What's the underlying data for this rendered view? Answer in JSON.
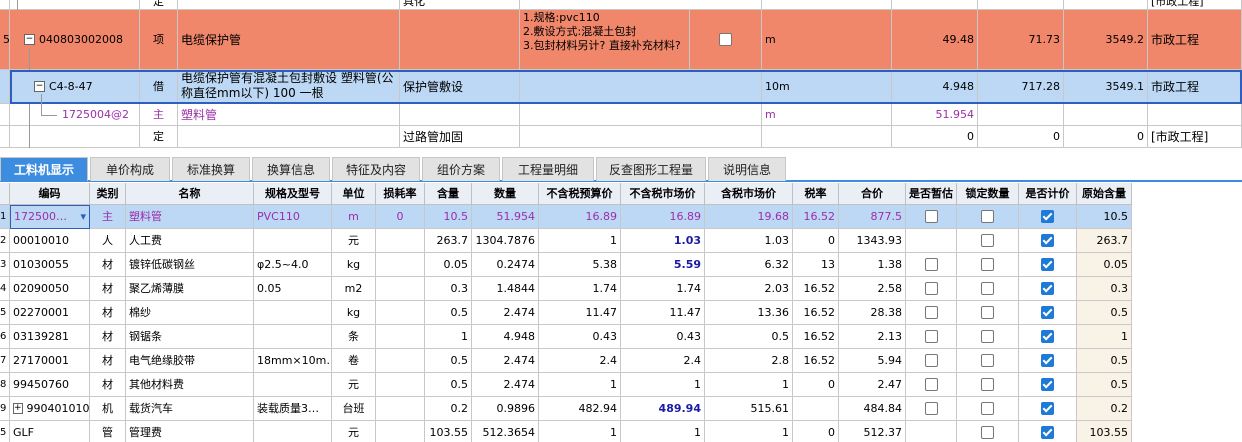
{
  "upper_rows": {
    "partial": {
      "type": "定",
      "name": "",
      "feature": "具化",
      "unit": "",
      "qty": "",
      "price": "",
      "total": "",
      "major": "[市政工程]"
    },
    "row_item": {
      "idx": "5",
      "code": "040803002008",
      "type": "项",
      "name": "电缆保护管",
      "feature": "1.规格:pvc110\n2.敷设方式:混凝土包封\n3.包封材料另计? 直接补充材料?",
      "unit": "m",
      "qty": "49.48",
      "price": "71.73",
      "total": "3549.2",
      "major": "市政工程"
    },
    "row_quota": {
      "code": "C4-8-47",
      "type": "借",
      "name": "电缆保护管有混凝土包封敷设 塑料管(公称直径mm以下) 100 一根",
      "work": "保护管敷设",
      "unit": "10m",
      "qty": "4.948",
      "price": "717.28",
      "total": "3549.1",
      "major": "市政工程"
    },
    "row_material": {
      "code": "1725004@2",
      "type": "主",
      "name": "塑料管",
      "unit": "m",
      "qty": "51.954"
    },
    "row_quota2": {
      "type": "定",
      "work": "过路管加固",
      "qty": "0",
      "price": "0",
      "total": "0",
      "major": "[市政工程]"
    }
  },
  "tabs": [
    "工料机显示",
    "单价构成",
    "标准换算",
    "换算信息",
    "特征及内容",
    "组价方案",
    "工程量明细",
    "反查图形工程量",
    "说明信息"
  ],
  "columns": [
    "编码",
    "类别",
    "名称",
    "规格及型号",
    "单位",
    "损耗率",
    "含量",
    "数量",
    "不含税预算价",
    "不含税市场价",
    "含税市场价",
    "税率",
    "合价",
    "是否暂估",
    "锁定数量",
    "是否计价",
    "原始含量"
  ],
  "rows": [
    {
      "idx": "1",
      "code": "172500…",
      "type": "主",
      "name": "塑料管",
      "spec": "PVC110",
      "unit": "m",
      "loss": "0",
      "content": "10.5",
      "qty": "51.954",
      "bp": "16.89",
      "mp": "16.89",
      "mpt": "19.68",
      "tax": "16.52",
      "total": "877.5",
      "est": false,
      "lock": false,
      "price": true,
      "orig": "10.5"
    },
    {
      "idx": "2",
      "code": "00010010",
      "type": "人",
      "name": "人工费",
      "spec": "",
      "unit": "元",
      "loss": "",
      "content": "263.7",
      "qty": "1304.7876",
      "bp": "1",
      "mp": "1.03",
      "mpt": "1.03",
      "tax": "0",
      "total": "1343.93",
      "est": null,
      "lock": false,
      "price": true,
      "orig": "263.7"
    },
    {
      "idx": "3",
      "code": "01030055",
      "type": "材",
      "name": "镀锌低碳钢丝",
      "spec": "φ2.5~4.0",
      "unit": "kg",
      "loss": "",
      "content": "0.05",
      "qty": "0.2474",
      "bp": "5.38",
      "mp": "5.59",
      "mpt": "6.32",
      "tax": "13",
      "total": "1.38",
      "est": false,
      "lock": false,
      "price": true,
      "orig": "0.05"
    },
    {
      "idx": "4",
      "code": "02090050",
      "type": "材",
      "name": "聚乙烯薄膜",
      "spec": "0.05",
      "unit": "m2",
      "loss": "",
      "content": "0.3",
      "qty": "1.4844",
      "bp": "1.74",
      "mp": "1.74",
      "mpt": "2.03",
      "tax": "16.52",
      "total": "2.58",
      "est": false,
      "lock": false,
      "price": true,
      "orig": "0.3"
    },
    {
      "idx": "5",
      "code": "02270001",
      "type": "材",
      "name": "棉纱",
      "spec": "",
      "unit": "kg",
      "loss": "",
      "content": "0.5",
      "qty": "2.474",
      "bp": "11.47",
      "mp": "11.47",
      "mpt": "13.36",
      "tax": "16.52",
      "total": "28.38",
      "est": false,
      "lock": false,
      "price": true,
      "orig": "0.5"
    },
    {
      "idx": "6",
      "code": "03139281",
      "type": "材",
      "name": "钢锯条",
      "spec": "",
      "unit": "条",
      "loss": "",
      "content": "1",
      "qty": "4.948",
      "bp": "0.43",
      "mp": "0.43",
      "mpt": "0.5",
      "tax": "16.52",
      "total": "2.13",
      "est": false,
      "lock": false,
      "price": true,
      "orig": "1"
    },
    {
      "idx": "7",
      "code": "27170001",
      "type": "材",
      "name": "电气绝缘胶带",
      "spec": "18mm×10m…",
      "unit": "卷",
      "loss": "",
      "content": "0.5",
      "qty": "2.474",
      "bp": "2.4",
      "mp": "2.4",
      "mpt": "2.8",
      "tax": "16.52",
      "total": "5.94",
      "est": false,
      "lock": false,
      "price": true,
      "orig": "0.5"
    },
    {
      "idx": "8",
      "code": "99450760",
      "type": "材",
      "name": "其他材料费",
      "spec": "",
      "unit": "元",
      "loss": "",
      "content": "0.5",
      "qty": "2.474",
      "bp": "1",
      "mp": "1",
      "mpt": "1",
      "tax": "0",
      "total": "2.47",
      "est": false,
      "lock": false,
      "price": true,
      "orig": "0.5"
    },
    {
      "idx": "9",
      "code": "990401010",
      "type": "机",
      "name": "载货汽车",
      "spec": "装载质量3…",
      "unit": "台班",
      "loss": "",
      "content": "0.2",
      "qty": "0.9896",
      "bp": "482.94",
      "mp": "489.94",
      "mpt": "515.61",
      "tax": "",
      "total": "484.84",
      "est": false,
      "lock": false,
      "price": true,
      "orig": "0.2"
    },
    {
      "idx": "5",
      "code": "GLF",
      "type": "管",
      "name": "管理费",
      "spec": "",
      "unit": "元",
      "loss": "",
      "content": "103.55",
      "qty": "512.3654",
      "bp": "1",
      "mp": "1",
      "mpt": "1",
      "tax": "0",
      "total": "512.37",
      "est": null,
      "lock": false,
      "price": true,
      "orig": "103.55"
    }
  ]
}
